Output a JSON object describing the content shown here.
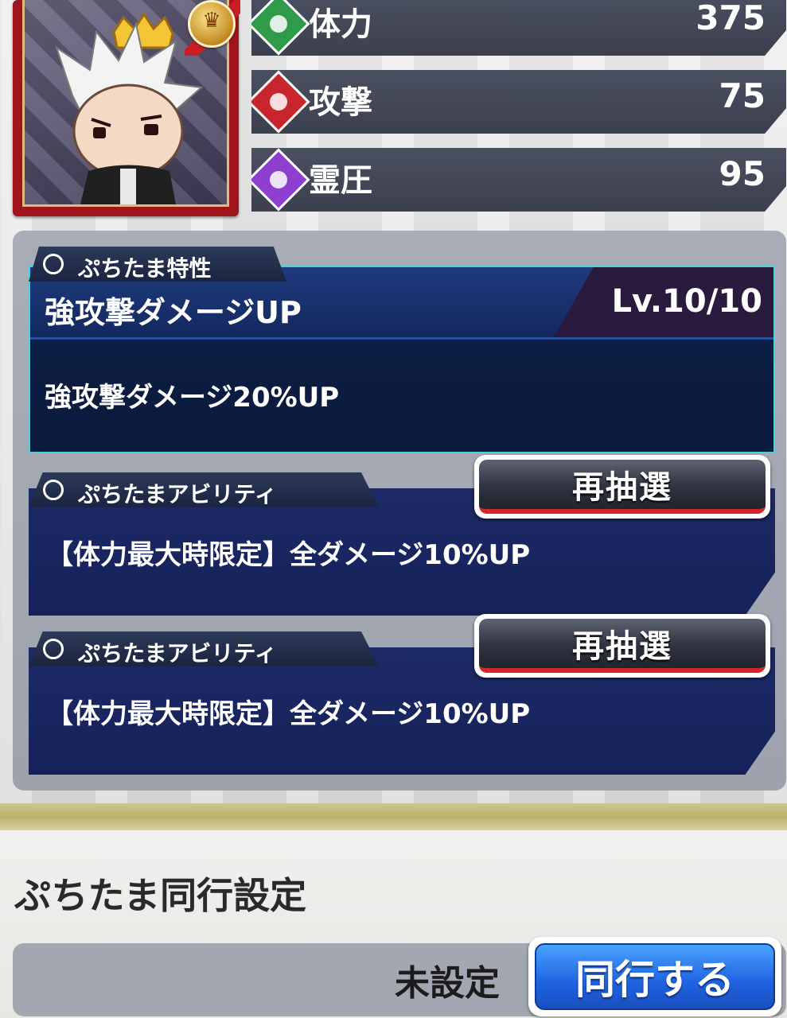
{
  "stats": [
    {
      "label": "体力",
      "value": "375",
      "icon": "leaf-icon",
      "color": "#2f9a4a"
    },
    {
      "label": "攻撃",
      "value": "75",
      "icon": "crossed-swords-icon",
      "color": "#c8262c"
    },
    {
      "label": "霊圧",
      "value": "95",
      "icon": "spirit-flame-icon",
      "color": "#8e3fd0"
    }
  ],
  "trait": {
    "tag": "ぷちたま特性",
    "name": "強攻撃ダメージUP",
    "level": "Lv.10/10",
    "description": "強攻撃ダメージ20%UP"
  },
  "abilities": [
    {
      "tag": "ぷちたまアビリティ",
      "description": "【体力最大時限定】全ダメージ10%UP",
      "reroll_label": "再抽選"
    },
    {
      "tag": "ぷちたまアビリティ",
      "description": "【体力最大時限定】全ダメージ10%UP",
      "reroll_label": "再抽選"
    }
  ],
  "companion": {
    "title": "ぷちたま同行設定",
    "status": "未設定",
    "button_label": "同行する"
  },
  "colors": {
    "accent_blue": "#1f62e0",
    "reroll_red": "#d3262c",
    "panel_navy": "#16215a"
  }
}
